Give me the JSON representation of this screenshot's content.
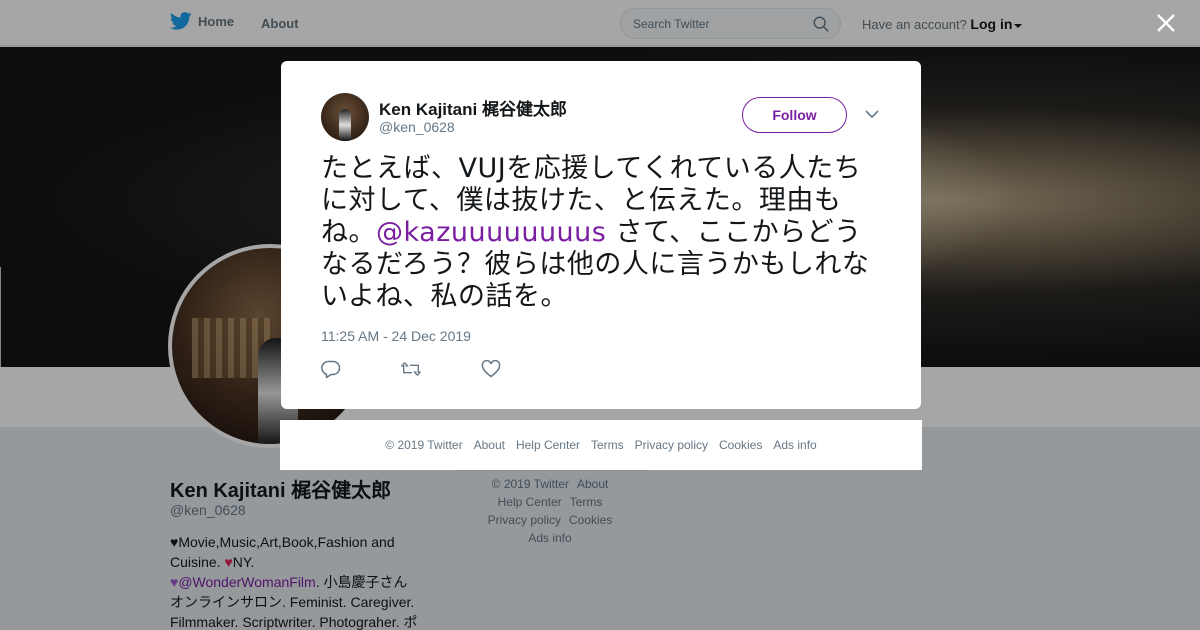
{
  "topbar": {
    "home_label": "Home",
    "about_label": "About",
    "search_placeholder": "Search Twitter",
    "account_prompt": "Have an account?",
    "login_label": "Log in"
  },
  "profile": {
    "name": "Ken Kajitani 梶谷健太郎",
    "handle": "@ken_0628",
    "bio_line1": "Movie,Music,Art,Book,Fashion and Cuisine.",
    "bio_ny": "NY.",
    "bio_mention": "@WonderWomanFilm",
    "bio_line3": ". 小島慶子さん",
    "bio_line4": "オンラインサロン. Feminist. Caregiver.",
    "bio_line5": "Filmmaker. Scriptwriter. Photograher. ポ"
  },
  "bg_footer": {
    "items": [
      "© 2019 Twitter",
      "About",
      "Help Center",
      "Terms",
      "Privacy policy",
      "Cookies",
      "Ads info"
    ]
  },
  "modal": {
    "author_name": "Ken Kajitani 梶谷健太郎",
    "author_handle": "@ken_0628",
    "follow_label": "Follow",
    "text_before": "たとえば、VUJを応援してくれている人たちに対して、僕は抜けた、と伝えた。理由もね。",
    "mention": "@kazuuuuuuuus",
    "text_after": " さて、ここからどうなるだろう？彼らは他の人に言うかもしれないよね、私の話を。",
    "timestamp": "11:25 AM - 24 Dec 2019"
  },
  "modal_footer": {
    "items": [
      "© 2019 Twitter",
      "About",
      "Help Center",
      "Terms",
      "Privacy policy",
      "Cookies",
      "Ads info"
    ]
  },
  "colors": {
    "accent": "#7b1fa2",
    "twitter_blue": "#1da1f2",
    "muted": "#657786"
  },
  "icons": {
    "logo": "twitter-bird-icon",
    "search": "search-icon",
    "close": "close-icon",
    "chevron": "chevron-down-icon",
    "reply": "reply-icon",
    "retweet": "retweet-icon",
    "like": "heart-icon"
  }
}
